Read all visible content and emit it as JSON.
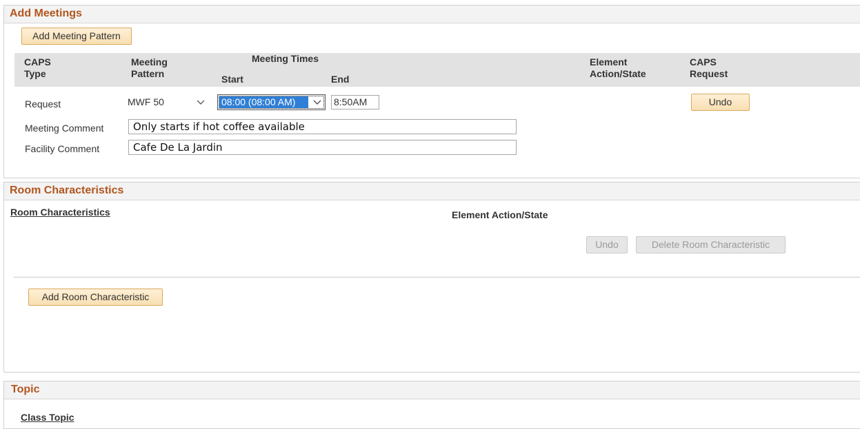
{
  "add_meetings": {
    "title": "Add Meetings",
    "add_pattern_button": "Add Meeting Pattern",
    "grid_headers": {
      "caps_type": "CAPS Type",
      "meeting_pattern": "Meeting Pattern",
      "meeting_times": "Meeting Times",
      "start": "Start",
      "end": "End",
      "element_action_state": "Element Action/State",
      "caps_request": "CAPS Request"
    },
    "row": {
      "caps_type": "Request",
      "pattern_value": "MWF 50",
      "start_value": "08:00 (08:00 AM)",
      "end_value": "8:50AM",
      "undo_button": "Undo"
    },
    "meeting_comment_label": "Meeting Comment",
    "meeting_comment_value": "Only starts if hot coffee available",
    "facility_comment_label": "Facility Comment",
    "facility_comment_value": "Cafe De La Jardin"
  },
  "room_characteristics": {
    "title": "Room Characteristics",
    "column_header": "Room Characteristics",
    "element_action_state": "Element Action/State",
    "undo_button": "Undo",
    "delete_button": "Delete Room Characteristic",
    "add_button": "Add Room Characteristic"
  },
  "topic": {
    "title": "Topic",
    "class_topic_header": "Class Topic"
  },
  "colors": {
    "section_title": "#b2561e",
    "button_bg": "#f8dfb2",
    "selection_bg": "#2f7fd6",
    "grid_header_bg": "#e2e2e2"
  }
}
